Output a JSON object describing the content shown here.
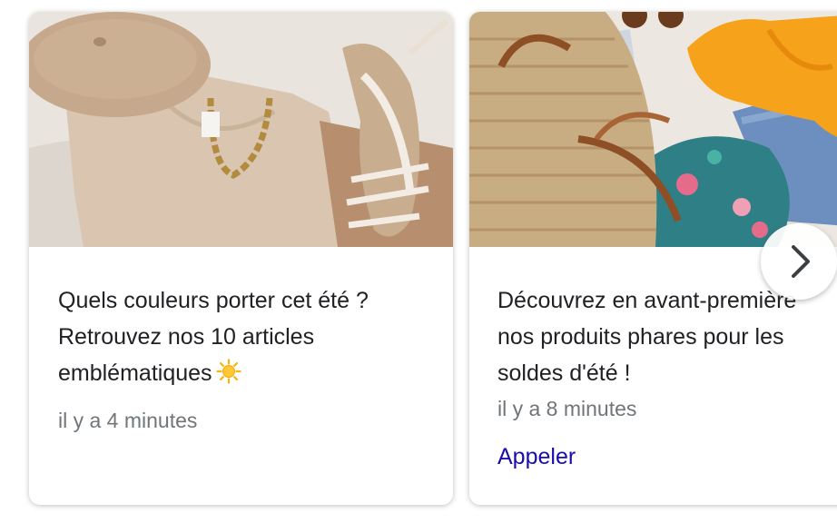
{
  "cards": [
    {
      "title_lines": [
        "Quels couleurs porter cet été ?",
        "Retrouvez nos 10 articles",
        "emblématiques"
      ],
      "time": "il y a 4 minutes",
      "image_icon": "clothing-flatlay-beret-sandals",
      "emoji_icon": "sun-icon"
    },
    {
      "title_lines": [
        "Découvrez en avant-première",
        "nos produits phares pour les",
        "soldes d'été !"
      ],
      "time": "il y a 8 minutes",
      "action_label": "Appeler",
      "image_icon": "straw-bag-swimsuit-flatlay"
    }
  ],
  "navigation": {
    "next_icon": "chevron-right-icon"
  },
  "colors": {
    "title": "#202124",
    "time": "#70757a",
    "link": "#1a0dab"
  }
}
